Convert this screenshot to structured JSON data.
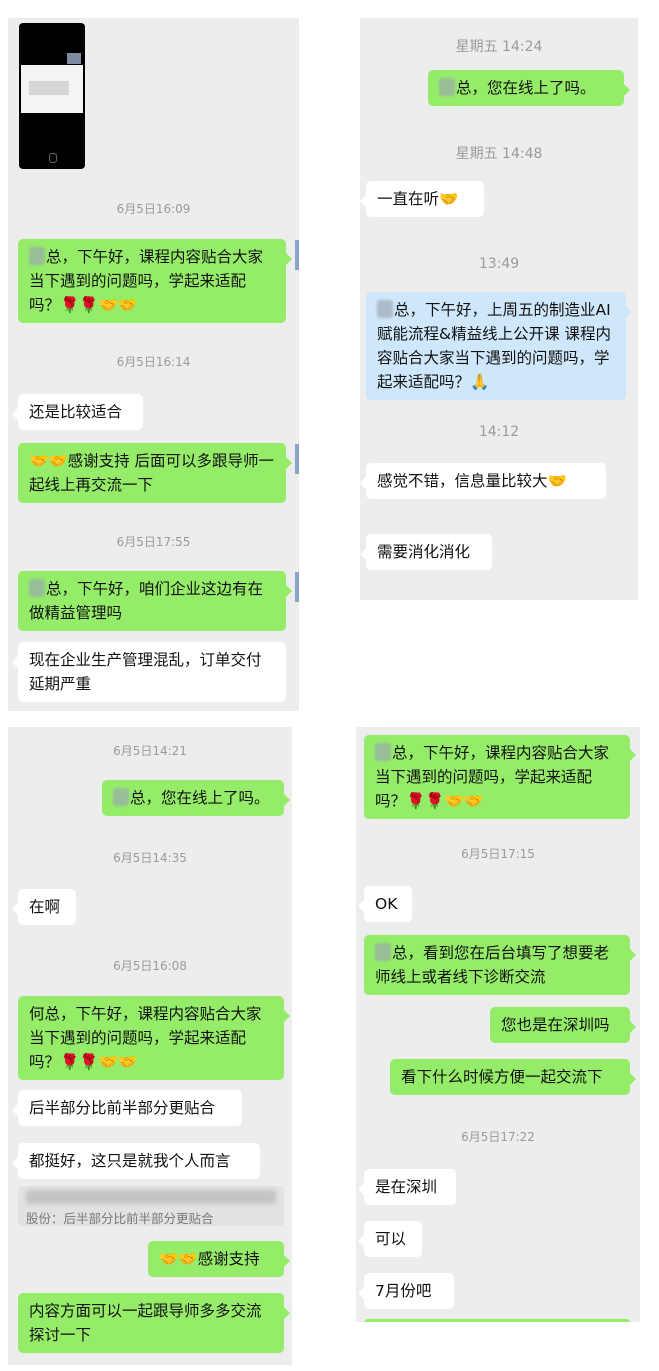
{
  "panel1": {
    "time1": "6月5日16:09",
    "msg1": "总，下午好，课程内容贴合大家当下遇到的问题吗，学起来适配吗？🌹🌹🤝🤝",
    "time2": "6月5日16:14",
    "msg2": "还是比较适合",
    "msg3": "🤝🤝感谢支持 后面可以多跟导师一起线上再交流一下",
    "time3": "6月5日17:55",
    "msg4": "总，下午好，咱们企业这边有在做精益管理吗",
    "msg5": "现在企业生产管理混乱，订单交付延期严重"
  },
  "panel2": {
    "time1": "星期五 14:24",
    "msg1": "总，您在线上了吗。",
    "time2": "星期五 14:48",
    "msg2": "一直在听🤝",
    "time3": "13:49",
    "msg3": "总，下午好，上周五的制造业AI赋能流程&精益线上公开课 课程内容贴合大家当下遇到的问题吗，学起来适配吗？🙏",
    "time4": "14:12",
    "msg4": "感觉不错，信息量比较大🤝",
    "msg5": "需要消化消化"
  },
  "panel3": {
    "time1": "6月5日14:21",
    "msg1": "总，您在线上了吗。",
    "time2": "6月5日14:35",
    "msg2": "在啊",
    "time3": "6月5日16:08",
    "msg3": "何总，下午好，课程内容贴合大家当下遇到的问题吗，学起来适配吗？🌹🌹🤝🤝",
    "msg4": "后半部分比前半部分更贴合",
    "msg5": "都挺好，这只是就我个人而言",
    "quote": "股份：后半部分比前半部分更贴合",
    "msg6": "🤝🤝感谢支持",
    "msg7": "内容方面可以一起跟导师多多交流探讨一下"
  },
  "panel4": {
    "msg1": "总，下午好，课程内容贴合大家当下遇到的问题吗，学起来适配吗？🌹🌹🤝🤝",
    "time1": "6月5日17:15",
    "msg2": "OK",
    "msg3": "总，看到您在后台填写了想要老师线上或者线下诊断交流",
    "msg4": "您也是在深圳吗",
    "msg5": "看下什么时候方便一起交流下",
    "time2": "6月5日17:22",
    "msg6": "是在深圳",
    "msg7": "可以",
    "msg8": "7月份吧"
  },
  "colors": {
    "green": "#95ec69",
    "white": "#ffffff",
    "blue": "#cfe7fb",
    "bg": "#ededed"
  },
  "icons": {
    "handshake": "🤝",
    "rose": "🌹",
    "pray": "🙏"
  }
}
